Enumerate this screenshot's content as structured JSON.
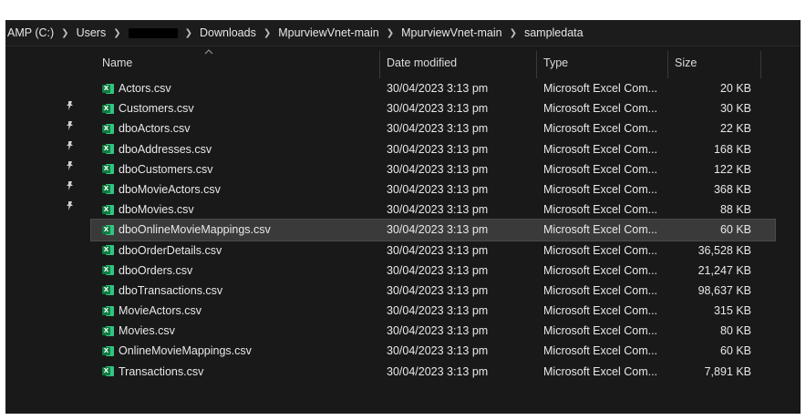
{
  "address": {
    "crumbs": [
      "AMP (C:)",
      "Users",
      "Downloads",
      "MpurviewVnet-main",
      "MpurviewVnet-main",
      "sampledata"
    ]
  },
  "header": {
    "name": "Name",
    "date": "Date modified",
    "type": "Type",
    "size": "Size"
  },
  "icons": {
    "file": "excel-csv-icon",
    "pin": "pin-icon",
    "sort": "chevron-up-icon",
    "separator": "chevron-right-icon"
  },
  "colors": {
    "background": "#191919",
    "selected_row": "#3a3a3a",
    "excel_green": "#107c41"
  },
  "files": [
    {
      "name": "Actors.csv",
      "date": "30/04/2023 3:13 pm",
      "type": "Microsoft Excel Com...",
      "size": "20 KB"
    },
    {
      "name": "Customers.csv",
      "date": "30/04/2023 3:13 pm",
      "type": "Microsoft Excel Com...",
      "size": "30 KB"
    },
    {
      "name": "dboActors.csv",
      "date": "30/04/2023 3:13 pm",
      "type": "Microsoft Excel Com...",
      "size": "22 KB"
    },
    {
      "name": "dboAddresses.csv",
      "date": "30/04/2023 3:13 pm",
      "type": "Microsoft Excel Com...",
      "size": "168 KB"
    },
    {
      "name": "dboCustomers.csv",
      "date": "30/04/2023 3:13 pm",
      "type": "Microsoft Excel Com...",
      "size": "122 KB"
    },
    {
      "name": "dboMovieActors.csv",
      "date": "30/04/2023 3:13 pm",
      "type": "Microsoft Excel Com...",
      "size": "368 KB"
    },
    {
      "name": "dboMovies.csv",
      "date": "30/04/2023 3:13 pm",
      "type": "Microsoft Excel Com...",
      "size": "88 KB"
    },
    {
      "name": "dboOnlineMovieMappings.csv",
      "date": "30/04/2023 3:13 pm",
      "type": "Microsoft Excel Com...",
      "size": "60 KB",
      "selected": true
    },
    {
      "name": "dboOrderDetails.csv",
      "date": "30/04/2023 3:13 pm",
      "type": "Microsoft Excel Com...",
      "size": "36,528 KB"
    },
    {
      "name": "dboOrders.csv",
      "date": "30/04/2023 3:13 pm",
      "type": "Microsoft Excel Com...",
      "size": "21,247 KB"
    },
    {
      "name": "dboTransactions.csv",
      "date": "30/04/2023 3:13 pm",
      "type": "Microsoft Excel Com...",
      "size": "98,637 KB"
    },
    {
      "name": "MovieActors.csv",
      "date": "30/04/2023 3:13 pm",
      "type": "Microsoft Excel Com...",
      "size": "315 KB"
    },
    {
      "name": "Movies.csv",
      "date": "30/04/2023 3:13 pm",
      "type": "Microsoft Excel Com...",
      "size": "80 KB"
    },
    {
      "name": "OnlineMovieMappings.csv",
      "date": "30/04/2023 3:13 pm",
      "type": "Microsoft Excel Com...",
      "size": "60 KB"
    },
    {
      "name": "Transactions.csv",
      "date": "30/04/2023 3:13 pm",
      "type": "Microsoft Excel Com...",
      "size": "7,891 KB"
    }
  ]
}
